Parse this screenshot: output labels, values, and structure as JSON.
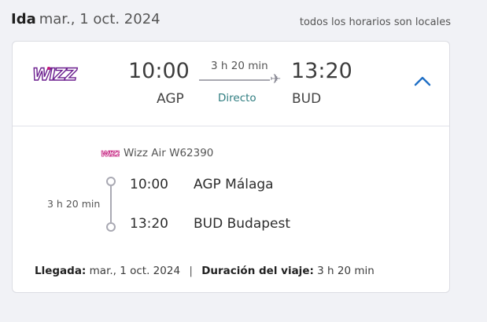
{
  "header": {
    "direction": "Ida",
    "date": "mar., 1 oct. 2024",
    "timezone_note": "todos los horarios son locales"
  },
  "summary": {
    "airline_logo": "wizz-logo",
    "departure_time": "10:00",
    "departure_code": "AGP",
    "arrival_time": "13:20",
    "arrival_code": "BUD",
    "duration": "3 h 20 min",
    "stops": "Directo",
    "plane_icon": "plane-icon",
    "collapse_icon": "chevron-up-icon"
  },
  "detail": {
    "carrier": "Wizz Air W62390",
    "segment_duration": "3 h 20 min",
    "departure_time": "10:00",
    "departure_place": "AGP Málaga",
    "arrival_time": "13:20",
    "arrival_place": "BUD Budapest",
    "arrival_label": "Llegada:",
    "arrival_date": "mar., 1 oct. 2024",
    "separator": "|",
    "trip_duration_label": "Duración del viaje:",
    "trip_duration": "3 h 20 min"
  },
  "colors": {
    "background": "#f1f2f6",
    "card": "#ffffff",
    "wizz_purple": "#6b1f8f",
    "wizz_pink": "#c2187a",
    "direct_teal": "#2f7d80",
    "chevron_blue": "#1f6fc5"
  }
}
